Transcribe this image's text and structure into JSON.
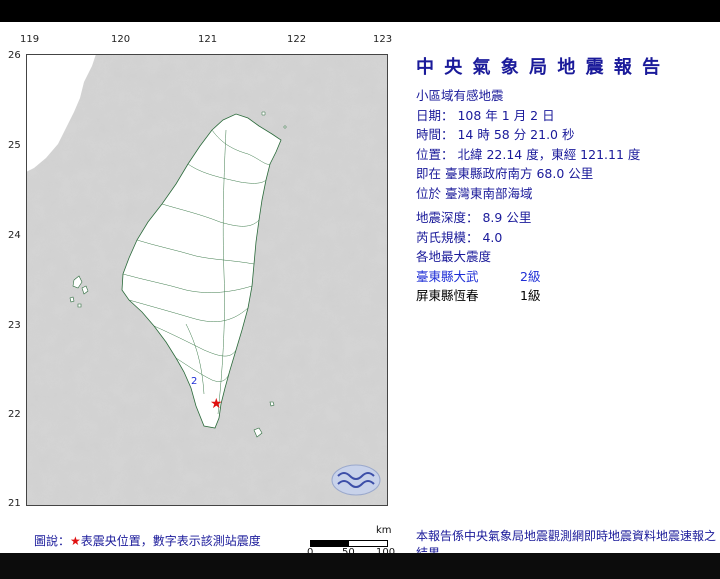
{
  "report": {
    "title": "中 央 氣 象 局 地 震 報 告",
    "subtitle": "小區域有感地震",
    "date": "日期： 108 年 1 月 2 日",
    "time": "時間： 14 時 58 分 21.0 秒",
    "position": "位置： 北緯 22.14 度，東經 121.11 度",
    "located_at": "即在 臺東縣政府南方 68.0 公里",
    "region": "位於 臺灣東南部海域",
    "depth": "地震深度： 8.9 公里",
    "magnitude": "芮氏規模： 4.0",
    "intensity_heading": "各地最大震度",
    "stations": [
      {
        "name": "臺東縣大武",
        "level": "2級"
      },
      {
        "name": "屏東縣恆春",
        "level": "1級"
      }
    ],
    "footer": "本報告係中央氣象局地震觀測網即時地震資料地震速報之結果。"
  },
  "map": {
    "legend_prefix": "圖說：",
    "legend_star": "★",
    "legend_text": "表震央位置，數字表示該測站震度",
    "lon_labels": [
      "119",
      "120",
      "121",
      "122",
      "123"
    ],
    "lat_labels": [
      "26",
      "25",
      "24",
      "23",
      "22",
      "21"
    ],
    "station_marker": "2",
    "scale_unit": "km",
    "scale_ticks": [
      "0",
      "50",
      "100"
    ],
    "epicenter_color": "#e01010",
    "land_color": "#ffffff",
    "sea_color": "#d9d9d9"
  }
}
